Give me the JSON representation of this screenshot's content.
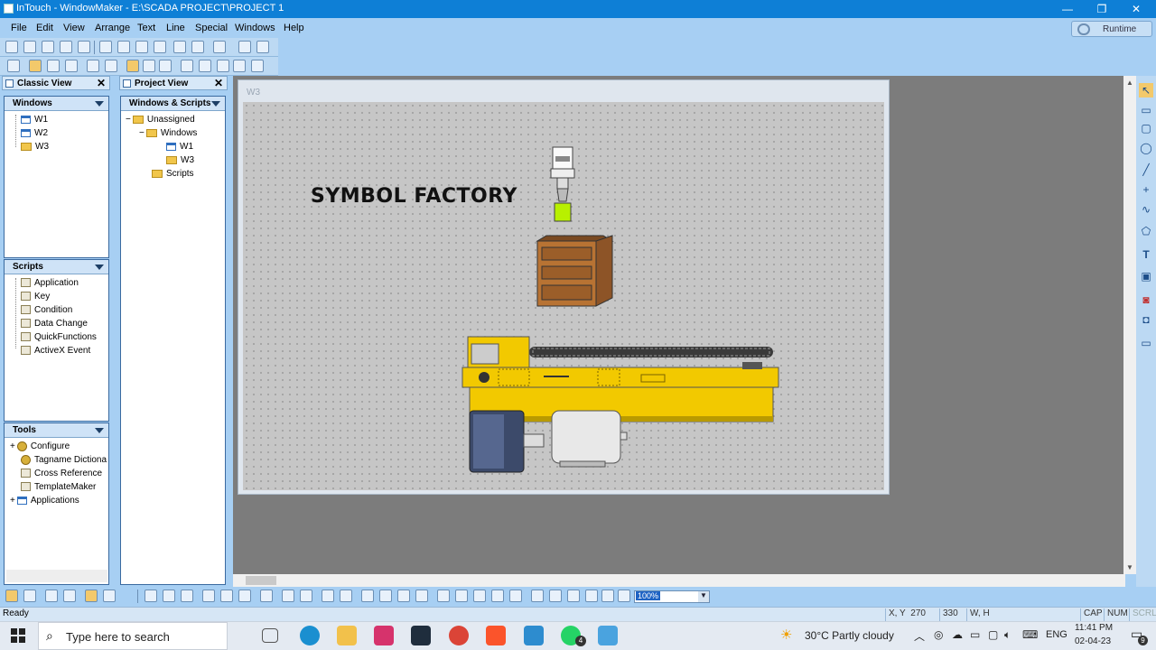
{
  "titlebar": {
    "title": "InTouch - WindowMaker - E:\\SCADA PROJECT\\PROJECT 1",
    "min": "—",
    "restore": "❐",
    "close": "✕"
  },
  "menus": [
    "File",
    "Edit",
    "View",
    "Arrange",
    "Text",
    "Line",
    "Special",
    "Windows",
    "Help"
  ],
  "runtime_label": "Runtime",
  "classic_view": {
    "title": "Classic View",
    "close": "✕",
    "windows_header": "Windows",
    "windows": [
      "W1",
      "W2",
      "W3"
    ],
    "scripts_header": "Scripts",
    "scripts": [
      "Application",
      "Key",
      "Condition",
      "Data Change",
      "QuickFunctions",
      "ActiveX Event"
    ],
    "tools_header": "Tools",
    "tools": [
      "Configure",
      "Tagname Dictiona",
      "Cross Reference",
      "TemplateMaker",
      "Applications"
    ]
  },
  "project_view": {
    "title": "Project View",
    "close": "✕",
    "header": "Windows & Scripts",
    "tree": {
      "root": "Unassigned",
      "windows_folder": "Windows",
      "windows": [
        "W1",
        "W3"
      ],
      "scripts_folder": "Scripts"
    },
    "expand_minus": "−",
    "expand_plus": "+"
  },
  "document": {
    "caption": "W3",
    "symbol_title": "SYMBOL FACTORY"
  },
  "zoom": {
    "value": "100%",
    "arrow": "▼"
  },
  "statusbar": {
    "ready": "Ready",
    "xy_label": "X, Y",
    "x": "270",
    "y": "330",
    "wh_label": "W, H",
    "cap": "CAP",
    "num": "NUM",
    "scrl": "SCRL"
  },
  "taskbar": {
    "search_placeholder": "Type here to search",
    "weather": "30°C  Partly cloudy",
    "lang": "ENG",
    "time": "11:41 PM",
    "date": "02-04-23",
    "whatsapp_badge": "4",
    "notif_badge": "9"
  },
  "colors": {
    "titlebar": "#0e7fd6",
    "workspace": "#7c7c7c",
    "canvas": "#c6c6c6",
    "conveyor_yellow": "#f2c900",
    "box_brown": "#b87333"
  }
}
